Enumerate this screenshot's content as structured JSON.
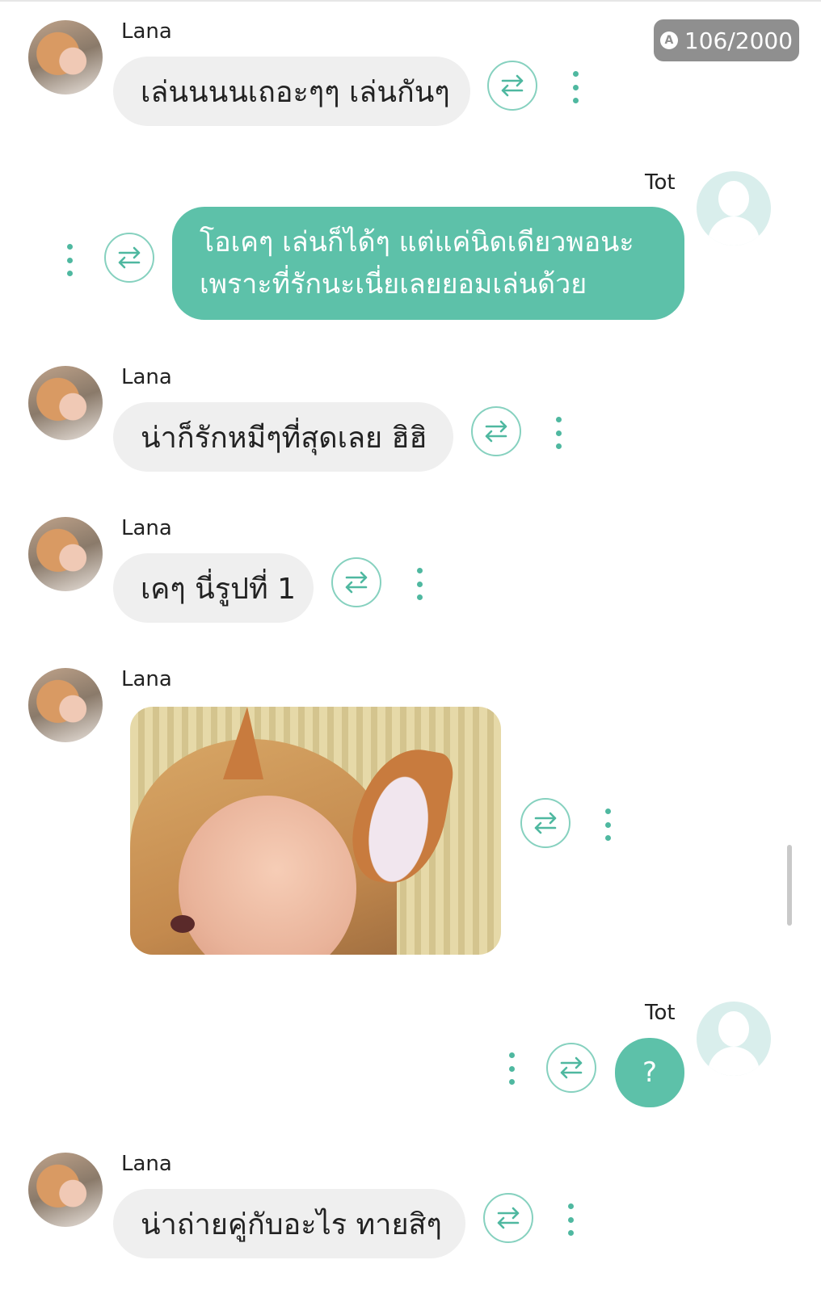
{
  "header": {
    "char_counter": "106/2000",
    "counter_badge": "A"
  },
  "messages": [
    {
      "sender": "Lana",
      "text": "เล่นนนนเถอะๆๆ เล่นกันๆ"
    },
    {
      "sender": "Tot",
      "lines": [
        "โอเคๆ เล่นก็ได้ๆ แต่แค่นิดเดียวพอนะ",
        "เพราะที่รักนะเนี่ยเลยยอมเล่นด้วย"
      ]
    },
    {
      "sender": "Lana",
      "text": "น่าก็รักหมีๆที่สุดเลย ฮิฮิ"
    },
    {
      "sender": "Lana",
      "text": "เคๆ นี่รูปที่ 1"
    },
    {
      "sender": "Lana",
      "image": "cat-ear-photo"
    },
    {
      "sender": "Tot",
      "text": "?"
    },
    {
      "sender": "Lana",
      "text": "น่าถ่ายคู่กับอะไร ทายสิๆ"
    }
  ],
  "colors": {
    "accent": "#5dc1a9",
    "incoming_bubble": "#efefef",
    "counter_bg": "#8f8f8f"
  },
  "icons": {
    "translate": "swap-arrows-icon",
    "menu": "more-vertical-icon"
  }
}
